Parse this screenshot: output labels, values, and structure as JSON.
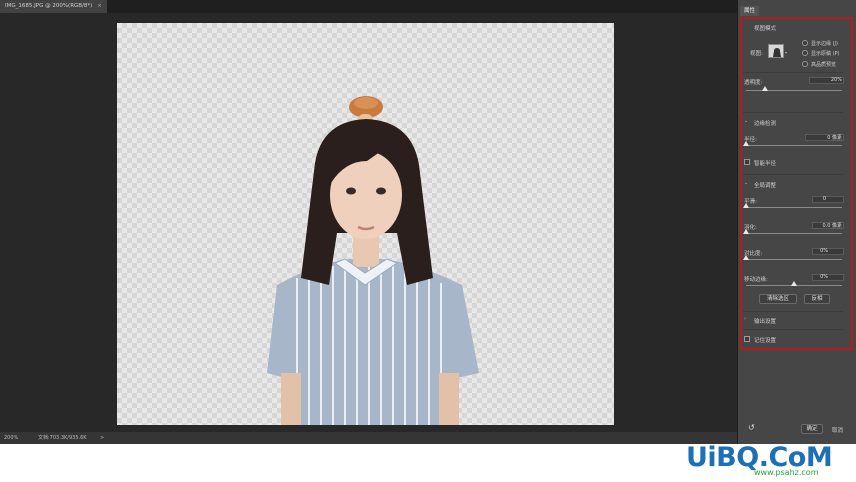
{
  "document_tab": {
    "title": "IMG_1685.JPG @ 200%(RGB/8*)",
    "close": "×"
  },
  "status": {
    "zoom": "200%",
    "doc_info": "文档:703.3K/935.6K",
    "arrow": ">"
  },
  "panel": {
    "tab_label": "属性",
    "view_mode": {
      "title": "视图模式",
      "view_label": "视图:",
      "options": [
        "显示边缘 (J)",
        "显示原稿 (P)",
        "高品质预览"
      ]
    },
    "opacity": {
      "label": "透明度:",
      "value": "20%",
      "fraction": 0.2
    },
    "edge_detection": {
      "title": "边缘检测",
      "radius_label": "半径:",
      "radius_value": "0 像素",
      "smart_radius": "智能半径"
    },
    "global_refine": {
      "title": "全局调整",
      "smooth_label": "平滑:",
      "smooth_value": "0",
      "feather_label": "羽化:",
      "feather_value": "0.0 像素",
      "contrast_label": "对比度:",
      "contrast_value": "0%",
      "shift_edge_label": "移动边缘:",
      "shift_edge_value": "0%",
      "shift_edge_fraction": 0.5,
      "clear_selection": "清除选区",
      "invert": "反相"
    },
    "output_settings": "输出设置",
    "remember_settings": "记住设置",
    "ok": "确定",
    "cancel": "取消"
  },
  "watermark": {
    "brand": "UiBQ.CoM",
    "url": "www.psahz.com"
  }
}
